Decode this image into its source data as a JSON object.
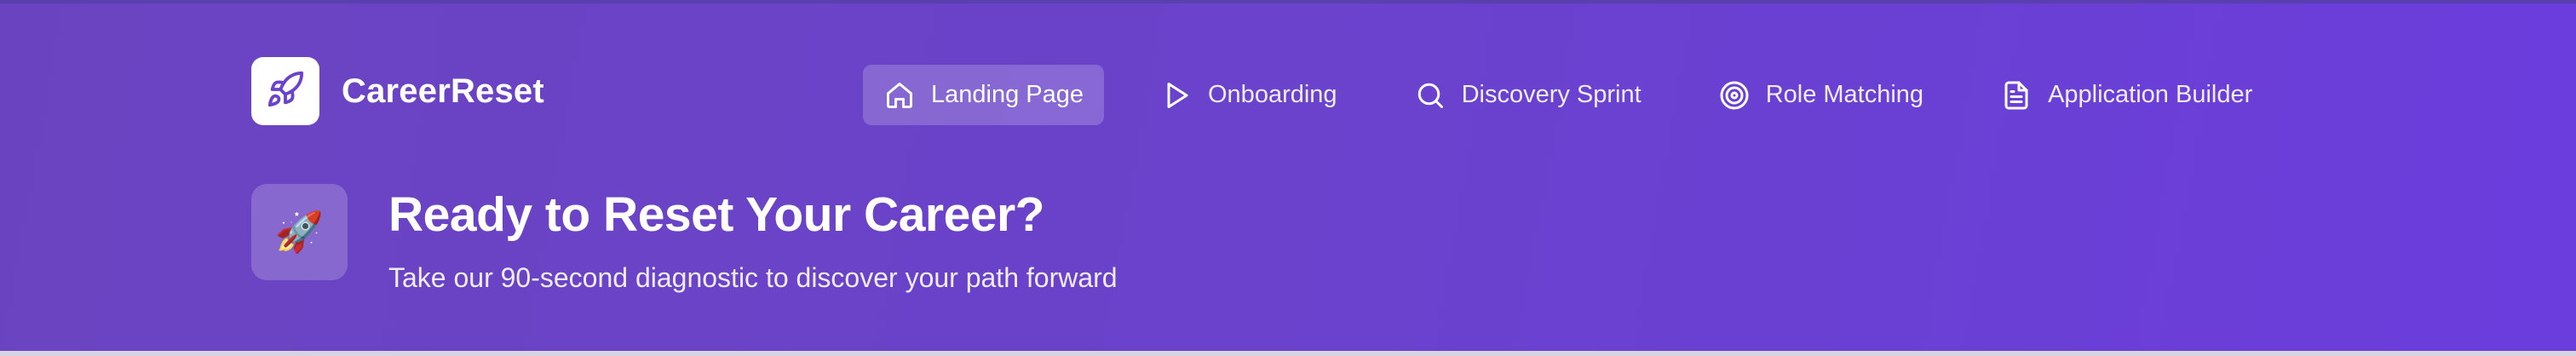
{
  "brand": {
    "name": "CareerReset",
    "icon": "rocket-icon",
    "accent_color": "#6b42cc"
  },
  "nav": {
    "items": [
      {
        "label": "Landing Page",
        "icon": "home-icon",
        "active": true
      },
      {
        "label": "Onboarding",
        "icon": "play-icon",
        "active": false
      },
      {
        "label": "Discovery Sprint",
        "icon": "search-icon",
        "active": false
      },
      {
        "label": "Role Matching",
        "icon": "target-icon",
        "active": false
      },
      {
        "label": "Application Builder",
        "icon": "document-icon",
        "active": false
      }
    ]
  },
  "hero": {
    "icon": "🚀",
    "title": "Ready to Reset Your Career?",
    "subtitle": "Take our 90-second diagnostic to discover your path forward"
  }
}
